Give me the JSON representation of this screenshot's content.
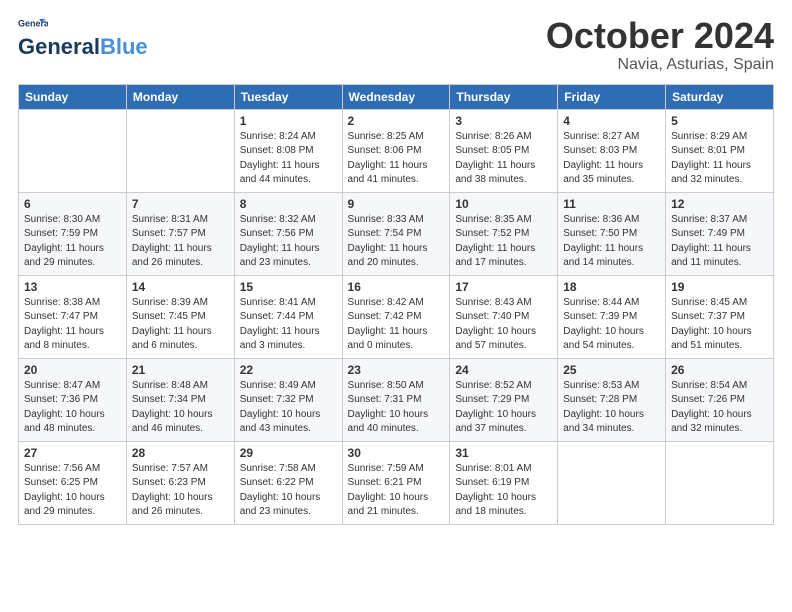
{
  "logo": {
    "line1": "General",
    "line2": "Blue"
  },
  "header": {
    "month": "October 2024",
    "location": "Navia, Asturias, Spain"
  },
  "weekdays": [
    "Sunday",
    "Monday",
    "Tuesday",
    "Wednesday",
    "Thursday",
    "Friday",
    "Saturday"
  ],
  "weeks": [
    [
      {
        "day": "",
        "info": ""
      },
      {
        "day": "",
        "info": ""
      },
      {
        "day": "1",
        "info": "Sunrise: 8:24 AM\nSunset: 8:08 PM\nDaylight: 11 hours\nand 44 minutes."
      },
      {
        "day": "2",
        "info": "Sunrise: 8:25 AM\nSunset: 8:06 PM\nDaylight: 11 hours\nand 41 minutes."
      },
      {
        "day": "3",
        "info": "Sunrise: 8:26 AM\nSunset: 8:05 PM\nDaylight: 11 hours\nand 38 minutes."
      },
      {
        "day": "4",
        "info": "Sunrise: 8:27 AM\nSunset: 8:03 PM\nDaylight: 11 hours\nand 35 minutes."
      },
      {
        "day": "5",
        "info": "Sunrise: 8:29 AM\nSunset: 8:01 PM\nDaylight: 11 hours\nand 32 minutes."
      }
    ],
    [
      {
        "day": "6",
        "info": "Sunrise: 8:30 AM\nSunset: 7:59 PM\nDaylight: 11 hours\nand 29 minutes."
      },
      {
        "day": "7",
        "info": "Sunrise: 8:31 AM\nSunset: 7:57 PM\nDaylight: 11 hours\nand 26 minutes."
      },
      {
        "day": "8",
        "info": "Sunrise: 8:32 AM\nSunset: 7:56 PM\nDaylight: 11 hours\nand 23 minutes."
      },
      {
        "day": "9",
        "info": "Sunrise: 8:33 AM\nSunset: 7:54 PM\nDaylight: 11 hours\nand 20 minutes."
      },
      {
        "day": "10",
        "info": "Sunrise: 8:35 AM\nSunset: 7:52 PM\nDaylight: 11 hours\nand 17 minutes."
      },
      {
        "day": "11",
        "info": "Sunrise: 8:36 AM\nSunset: 7:50 PM\nDaylight: 11 hours\nand 14 minutes."
      },
      {
        "day": "12",
        "info": "Sunrise: 8:37 AM\nSunset: 7:49 PM\nDaylight: 11 hours\nand 11 minutes."
      }
    ],
    [
      {
        "day": "13",
        "info": "Sunrise: 8:38 AM\nSunset: 7:47 PM\nDaylight: 11 hours\nand 8 minutes."
      },
      {
        "day": "14",
        "info": "Sunrise: 8:39 AM\nSunset: 7:45 PM\nDaylight: 11 hours\nand 6 minutes."
      },
      {
        "day": "15",
        "info": "Sunrise: 8:41 AM\nSunset: 7:44 PM\nDaylight: 11 hours\nand 3 minutes."
      },
      {
        "day": "16",
        "info": "Sunrise: 8:42 AM\nSunset: 7:42 PM\nDaylight: 11 hours\nand 0 minutes."
      },
      {
        "day": "17",
        "info": "Sunrise: 8:43 AM\nSunset: 7:40 PM\nDaylight: 10 hours\nand 57 minutes."
      },
      {
        "day": "18",
        "info": "Sunrise: 8:44 AM\nSunset: 7:39 PM\nDaylight: 10 hours\nand 54 minutes."
      },
      {
        "day": "19",
        "info": "Sunrise: 8:45 AM\nSunset: 7:37 PM\nDaylight: 10 hours\nand 51 minutes."
      }
    ],
    [
      {
        "day": "20",
        "info": "Sunrise: 8:47 AM\nSunset: 7:36 PM\nDaylight: 10 hours\nand 48 minutes."
      },
      {
        "day": "21",
        "info": "Sunrise: 8:48 AM\nSunset: 7:34 PM\nDaylight: 10 hours\nand 46 minutes."
      },
      {
        "day": "22",
        "info": "Sunrise: 8:49 AM\nSunset: 7:32 PM\nDaylight: 10 hours\nand 43 minutes."
      },
      {
        "day": "23",
        "info": "Sunrise: 8:50 AM\nSunset: 7:31 PM\nDaylight: 10 hours\nand 40 minutes."
      },
      {
        "day": "24",
        "info": "Sunrise: 8:52 AM\nSunset: 7:29 PM\nDaylight: 10 hours\nand 37 minutes."
      },
      {
        "day": "25",
        "info": "Sunrise: 8:53 AM\nSunset: 7:28 PM\nDaylight: 10 hours\nand 34 minutes."
      },
      {
        "day": "26",
        "info": "Sunrise: 8:54 AM\nSunset: 7:26 PM\nDaylight: 10 hours\nand 32 minutes."
      }
    ],
    [
      {
        "day": "27",
        "info": "Sunrise: 7:56 AM\nSunset: 6:25 PM\nDaylight: 10 hours\nand 29 minutes."
      },
      {
        "day": "28",
        "info": "Sunrise: 7:57 AM\nSunset: 6:23 PM\nDaylight: 10 hours\nand 26 minutes."
      },
      {
        "day": "29",
        "info": "Sunrise: 7:58 AM\nSunset: 6:22 PM\nDaylight: 10 hours\nand 23 minutes."
      },
      {
        "day": "30",
        "info": "Sunrise: 7:59 AM\nSunset: 6:21 PM\nDaylight: 10 hours\nand 21 minutes."
      },
      {
        "day": "31",
        "info": "Sunrise: 8:01 AM\nSunset: 6:19 PM\nDaylight: 10 hours\nand 18 minutes."
      },
      {
        "day": "",
        "info": ""
      },
      {
        "day": "",
        "info": ""
      }
    ]
  ]
}
